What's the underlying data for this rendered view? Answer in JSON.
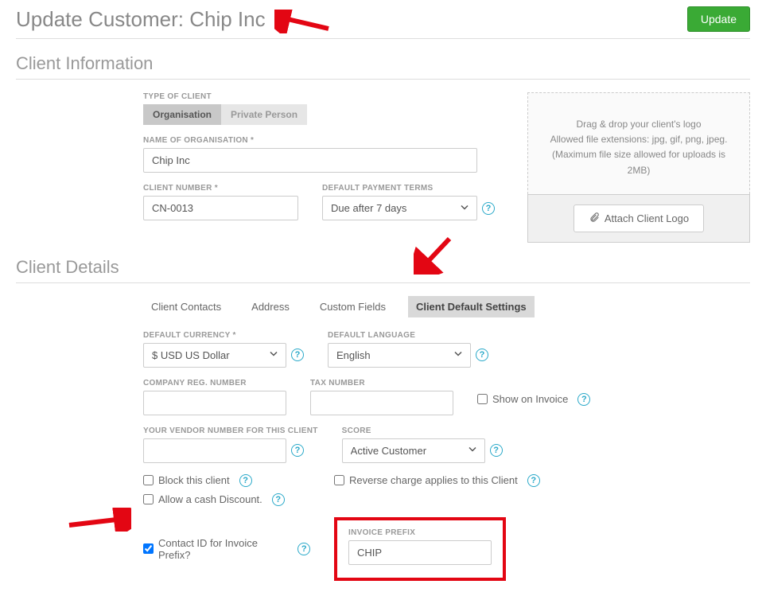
{
  "page": {
    "title": "Update Customer: Chip Inc",
    "update_button": "Update"
  },
  "client_info": {
    "section_title": "Client Information",
    "type_label": "TYPE OF CLIENT",
    "type_options": {
      "org": "Organisation",
      "private": "Private Person"
    },
    "name_label": "NAME OF ORGANISATION *",
    "name_value": "Chip Inc",
    "number_label": "CLIENT NUMBER *",
    "number_value": "CN-0013",
    "terms_label": "DEFAULT PAYMENT TERMS",
    "terms_value": "Due after 7 days",
    "dropzone_line1": "Drag & drop your client's logo",
    "dropzone_line2": "Allowed file extensions: jpg, gif, png, jpeg.",
    "dropzone_line3": "(Maximum file size allowed for uploads is 2MB)",
    "attach_button": "Attach Client Logo"
  },
  "client_details": {
    "section_title": "Client Details",
    "tabs": {
      "contacts": "Client Contacts",
      "address": "Address",
      "custom": "Custom Fields",
      "defaults": "Client Default Settings"
    },
    "currency_label": "DEFAULT CURRENCY *",
    "currency_value": "$ USD US Dollar",
    "language_label": "DEFAULT LANGUAGE",
    "language_value": "English",
    "reg_label": "COMPANY REG. NUMBER",
    "reg_value": "",
    "tax_label": "TAX NUMBER",
    "tax_value": "",
    "show_on_invoice": "Show on Invoice",
    "vendor_label": "YOUR VENDOR NUMBER FOR THIS CLIENT",
    "vendor_value": "",
    "score_label": "SCORE",
    "score_value": "Active Customer",
    "block_label": "Block this client",
    "reverse_label": "Reverse charge applies to this Client",
    "cash_discount_label": "Allow a cash Discount.",
    "contact_id_label": "Contact ID for Invoice Prefix?",
    "invoice_prefix_label": "INVOICE PREFIX",
    "invoice_prefix_value": "CHIP"
  }
}
